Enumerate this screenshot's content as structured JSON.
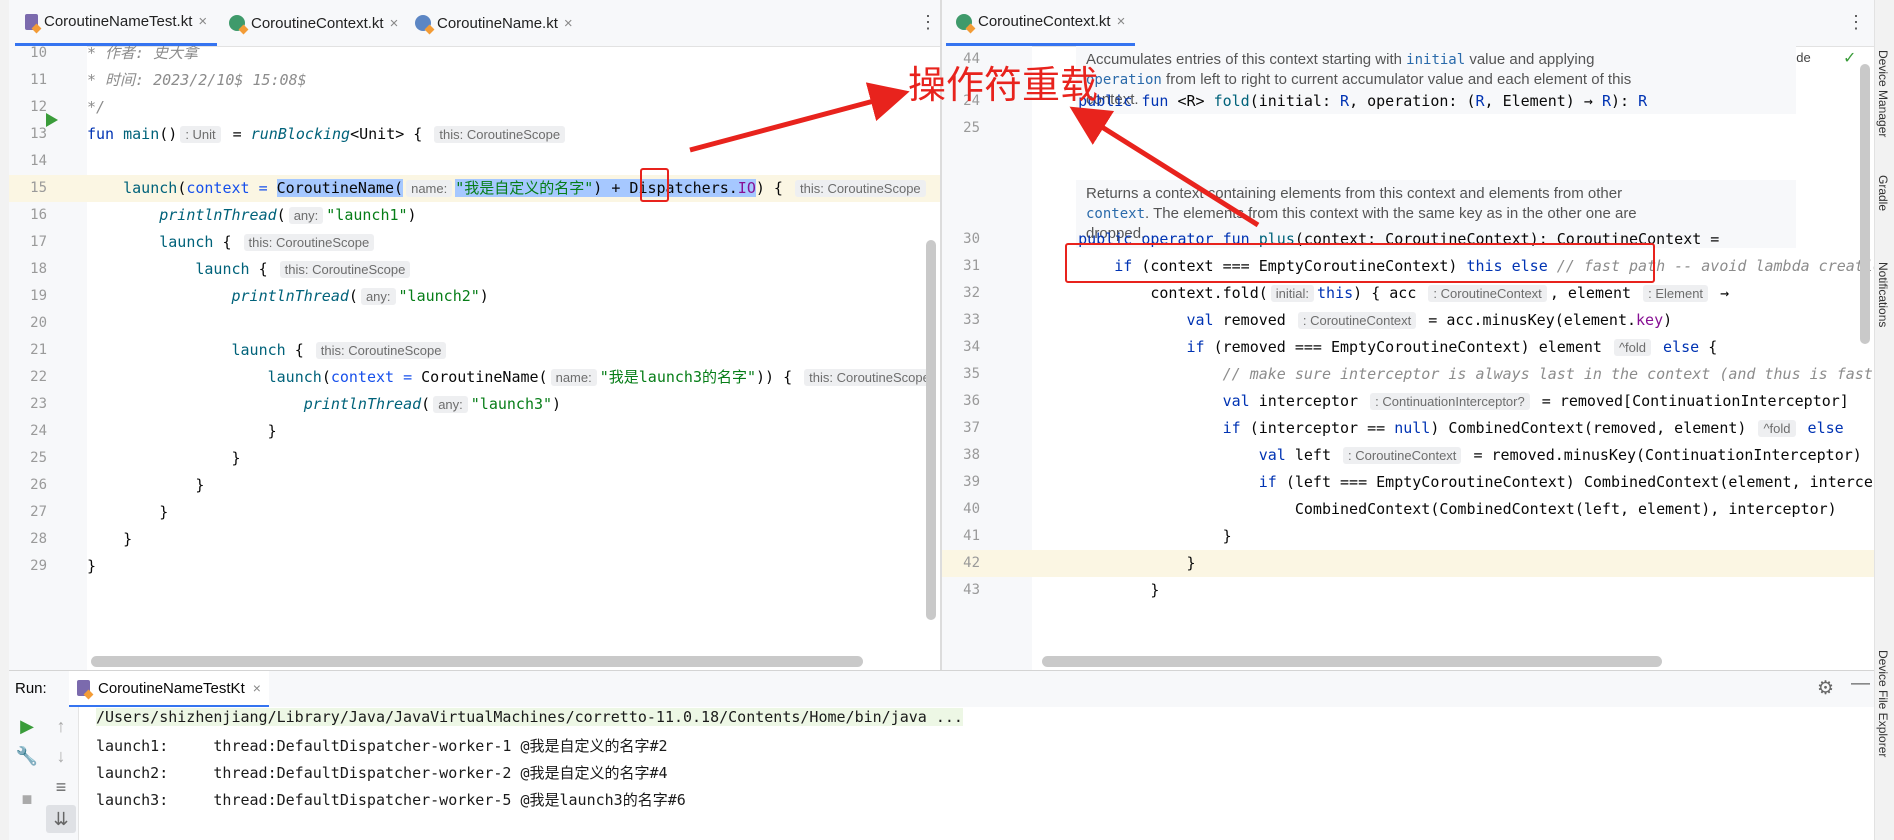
{
  "left_editor": {
    "tabs": [
      {
        "label": "CoroutineNameTest.kt",
        "close": "×",
        "active": true
      },
      {
        "label": "CoroutineContext.kt",
        "close": "×",
        "active": false
      },
      {
        "label": "CoroutineName.kt",
        "close": "×",
        "active": false
      }
    ],
    "menu_glyph": "⋮",
    "lines": [
      {
        "n": "10",
        "parts": [
          {
            "t": "* 作者: 史大拿",
            "c": "cm"
          }
        ]
      },
      {
        "n": "11",
        "parts": [
          {
            "t": "* 时间: 2023/2/10$ 15:08$",
            "c": "cm"
          }
        ]
      },
      {
        "n": "12",
        "parts": [
          {
            "t": "*/",
            "c": "cm"
          }
        ]
      },
      {
        "n": "13",
        "parts": [
          {
            "t": "fun ",
            "c": "kw"
          },
          {
            "t": "main",
            "c": "fn"
          },
          {
            "t": "()"
          },
          {
            "t": ": Unit",
            "c": "hint"
          },
          {
            "t": " = "
          },
          {
            "t": "runBlocking",
            "c": "fn it"
          },
          {
            "t": "<Unit> { "
          },
          {
            "t": "this: CoroutineScope",
            "c": "hint"
          }
        ]
      },
      {
        "n": "14",
        "parts": []
      },
      {
        "n": "15",
        "parts": [
          {
            "t": "    "
          },
          {
            "t": "launch",
            "c": "fn"
          },
          {
            "t": "("
          },
          {
            "t": "context = ",
            "c": "named"
          },
          {
            "t": "CoroutineName(",
            "c": "sel"
          },
          {
            "t": "name:",
            "c": "hint"
          },
          {
            "t": "\"我是自定义的名字\"",
            "c": "str sel"
          },
          {
            "t": ") + Dispatchers.",
            "c": "sel"
          },
          {
            "t": "IO",
            "c": "param sel"
          },
          {
            "t": ") { "
          },
          {
            "t": "this: CoroutineScope",
            "c": "hint"
          }
        ]
      },
      {
        "n": "16",
        "parts": [
          {
            "t": "        "
          },
          {
            "t": "printlnThread",
            "c": "fn it"
          },
          {
            "t": "("
          },
          {
            "t": "any:",
            "c": "hint"
          },
          {
            "t": "\"launch1\"",
            "c": "str"
          },
          {
            "t": ")"
          }
        ]
      },
      {
        "n": "17",
        "parts": [
          {
            "t": "        "
          },
          {
            "t": "launch",
            "c": "fn"
          },
          {
            "t": " { "
          },
          {
            "t": "this: CoroutineScope",
            "c": "hint"
          }
        ]
      },
      {
        "n": "18",
        "parts": [
          {
            "t": "            "
          },
          {
            "t": "launch",
            "c": "fn"
          },
          {
            "t": " { "
          },
          {
            "t": "this: CoroutineScope",
            "c": "hint"
          }
        ]
      },
      {
        "n": "19",
        "parts": [
          {
            "t": "                "
          },
          {
            "t": "printlnThread",
            "c": "fn it"
          },
          {
            "t": "("
          },
          {
            "t": "any:",
            "c": "hint"
          },
          {
            "t": "\"launch2\"",
            "c": "str"
          },
          {
            "t": ")"
          }
        ]
      },
      {
        "n": "20",
        "parts": []
      },
      {
        "n": "21",
        "parts": [
          {
            "t": "                "
          },
          {
            "t": "launch",
            "c": "fn"
          },
          {
            "t": " { "
          },
          {
            "t": "this: CoroutineScope",
            "c": "hint"
          }
        ]
      },
      {
        "n": "22",
        "parts": [
          {
            "t": "                    "
          },
          {
            "t": "launch",
            "c": "fn"
          },
          {
            "t": "("
          },
          {
            "t": "context = ",
            "c": "named"
          },
          {
            "t": "CoroutineName("
          },
          {
            "t": "name:",
            "c": "hint"
          },
          {
            "t": "\"我是launch3的名字\"",
            "c": "str"
          },
          {
            "t": ")) { "
          },
          {
            "t": "this: CoroutineScope",
            "c": "hint"
          }
        ]
      },
      {
        "n": "23",
        "parts": [
          {
            "t": "                        "
          },
          {
            "t": "printlnThread",
            "c": "fn it"
          },
          {
            "t": "("
          },
          {
            "t": "any:",
            "c": "hint"
          },
          {
            "t": "\"launch3\"",
            "c": "str"
          },
          {
            "t": ")"
          }
        ]
      },
      {
        "n": "24",
        "parts": [
          {
            "t": "                    }"
          }
        ]
      },
      {
        "n": "25",
        "parts": [
          {
            "t": "                }"
          }
        ]
      },
      {
        "n": "26",
        "parts": [
          {
            "t": "            }"
          }
        ]
      },
      {
        "n": "27",
        "parts": [
          {
            "t": "        }"
          }
        ]
      },
      {
        "n": "28",
        "parts": [
          {
            "t": "    }"
          }
        ]
      },
      {
        "n": "29",
        "parts": [
          {
            "t": "}"
          }
        ]
      }
    ]
  },
  "annotation": {
    "text": "操作符重载",
    "color": "#e8231d"
  },
  "right_editor": {
    "tabs": [
      {
        "label": "CoroutineContext.kt",
        "close": "×",
        "active": true
      }
    ],
    "menu_glyph": "⋮",
    "reader_mode": "Reader Mode",
    "doc1": {
      "t1": "Accumulates entries of this context starting with ",
      "k1": "initial",
      "t2": " value and applying",
      "k2": "operation",
      "t3": " from left to right to current accumulator value and each element of this",
      "t4": "context."
    },
    "doc2": {
      "t1": "Returns a context containing elements from this context and elements from other",
      "k1": "context",
      "t2": ". The elements from this context with the same key as in the other one are",
      "t3": "dropped."
    },
    "lines": [
      {
        "n": "24",
        "parts": [
          {
            "t": "    "
          },
          {
            "t": "public fun ",
            "c": "kw"
          },
          {
            "t": "<R> "
          },
          {
            "t": "fold",
            "c": "fn"
          },
          {
            "t": "(initial: "
          },
          {
            "t": "R",
            "c": "kw"
          },
          {
            "t": ", operation: ("
          },
          {
            "t": "R",
            "c": "kw"
          },
          {
            "t": ", Element) → "
          },
          {
            "t": "R",
            "c": "kw"
          },
          {
            "t": "): "
          },
          {
            "t": "R",
            "c": "kw"
          }
        ]
      },
      {
        "n": "25",
        "parts": []
      },
      {
        "n": "30",
        "parts": [
          {
            "t": "    "
          },
          {
            "t": "public operator fun ",
            "c": "kw"
          },
          {
            "t": "plus",
            "c": "fn"
          },
          {
            "t": "(context: CoroutineContext): CoroutineContext ="
          }
        ]
      },
      {
        "n": "31",
        "parts": [
          {
            "t": "        "
          },
          {
            "t": "if ",
            "c": "kw"
          },
          {
            "t": "(context === EmptyCoroutineContext) "
          },
          {
            "t": "this else ",
            "c": "kw"
          },
          {
            "t": "// fast path -- avoid lambda creation",
            "c": "cm"
          }
        ]
      },
      {
        "n": "32",
        "parts": [
          {
            "t": "            context.fold("
          },
          {
            "t": "initial:",
            "c": "hint"
          },
          {
            "t": "this",
            "c": "kw"
          },
          {
            "t": ") { acc "
          },
          {
            "t": ": CoroutineContext",
            "c": "hint"
          },
          {
            "t": ", element "
          },
          {
            "t": ": Element",
            "c": "hint"
          },
          {
            "t": " →"
          }
        ]
      },
      {
        "n": "33",
        "parts": [
          {
            "t": "                "
          },
          {
            "t": "val ",
            "c": "kw"
          },
          {
            "t": "removed "
          },
          {
            "t": ": CoroutineContext",
            "c": "hint"
          },
          {
            "t": " = acc.minusKey(element."
          },
          {
            "t": "key",
            "c": "param"
          },
          {
            "t": ")"
          }
        ]
      },
      {
        "n": "34",
        "parts": [
          {
            "t": "                "
          },
          {
            "t": "if ",
            "c": "kw"
          },
          {
            "t": "(removed === EmptyCoroutineContext) element "
          },
          {
            "t": "^fold",
            "c": "hint"
          },
          {
            "t": " else ",
            "c": "kw"
          },
          {
            "t": "{"
          }
        ]
      },
      {
        "n": "35",
        "parts": [
          {
            "t": "                    "
          },
          {
            "t": "// make sure interceptor is always last in the context (and thus is fast to get when present)",
            "c": "cm"
          }
        ]
      },
      {
        "n": "36",
        "parts": [
          {
            "t": "                    "
          },
          {
            "t": "val ",
            "c": "kw"
          },
          {
            "t": "interceptor "
          },
          {
            "t": ": ContinuationInterceptor?",
            "c": "hint"
          },
          {
            "t": " = removed[ContinuationInterceptor]"
          }
        ]
      },
      {
        "n": "37",
        "parts": [
          {
            "t": "                    "
          },
          {
            "t": "if ",
            "c": "kw"
          },
          {
            "t": "(interceptor == "
          },
          {
            "t": "null",
            "c": "kw"
          },
          {
            "t": ") CombinedContext(removed, element) "
          },
          {
            "t": "^fold",
            "c": "hint"
          },
          {
            "t": " else",
            "c": "kw"
          }
        ]
      },
      {
        "n": "38",
        "parts": [
          {
            "t": "                        "
          },
          {
            "t": "val ",
            "c": "kw"
          },
          {
            "t": "left "
          },
          {
            "t": ": CoroutineContext",
            "c": "hint"
          },
          {
            "t": " = removed.minusKey(ContinuationInterceptor)"
          }
        ]
      },
      {
        "n": "39",
        "parts": [
          {
            "t": "                        "
          },
          {
            "t": "if ",
            "c": "kw"
          },
          {
            "t": "(left === EmptyCoroutineContext) CombinedContext(element, interceptor)"
          }
        ]
      },
      {
        "n": "40",
        "parts": [
          {
            "t": "                            CombinedContext(CombinedContext(left, element), interceptor)"
          }
        ]
      },
      {
        "n": "41",
        "parts": [
          {
            "t": "                    }"
          }
        ]
      },
      {
        "n": "42",
        "parts": [
          {
            "t": "                }"
          }
        ]
      },
      {
        "n": "43",
        "parts": [
          {
            "t": "            }"
          }
        ]
      },
      {
        "n": "44",
        "parts": []
      }
    ]
  },
  "run_panel": {
    "label": "Run:",
    "tab": "CoroutineNameTestKt",
    "tab_close": "×",
    "output": [
      "/Users/shizhenjiang/Library/Java/JavaVirtualMachines/corretto-11.0.18/Contents/Home/bin/java ...",
      "launch1:     thread:DefaultDispatcher-worker-1 @我是自定义的名字#2",
      "launch2:     thread:DefaultDispatcher-worker-2 @我是自定义的名字#4",
      "launch3:     thread:DefaultDispatcher-worker-5 @我是launch3的名字#6"
    ]
  },
  "side_panels": {
    "device_manager": "Device Manager",
    "gradle": "Gradle",
    "notifications": "Notifications",
    "device_file_explorer": "Device File Explorer"
  },
  "colors": {
    "accent": "#3574f0",
    "annotation_red": "#e8231d",
    "selection": "#a6c8ff"
  }
}
